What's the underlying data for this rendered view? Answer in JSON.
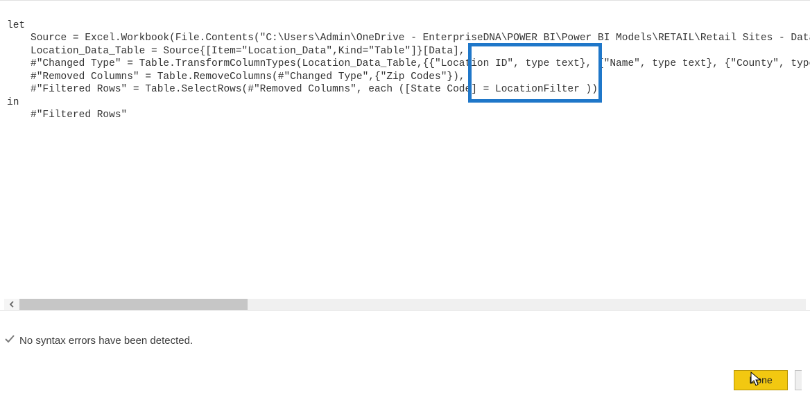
{
  "code": {
    "line1": "let",
    "line2": "Source = Excel.Workbook(File.Contents(\"C:\\Users\\Admin\\OneDrive - EnterpriseDNA\\POWER BI\\Power BI Models\\RETAIL\\Retail Sites - Data",
    "line3": "Location_Data_Table = Source{[Item=\"Location_Data\",Kind=\"Table\"]}[Data],",
    "line4": "#\"Changed Type\" = Table.TransformColumnTypes(Location_Data_Table,{{\"Location ID\", type text}, {\"Name\", type text}, {\"County\", type",
    "line5": "#\"Removed Columns\" = Table.RemoveColumns(#\"Changed Type\",{\"Zip Codes\"}),",
    "line6": "#\"Filtered Rows\" = Table.SelectRows(#\"Removed Columns\", each ([State Code] = LocationFilter ))",
    "line7": "in",
    "line8": "#\"Filtered Rows\""
  },
  "status": {
    "message": "No syntax errors have been detected."
  },
  "buttons": {
    "done": "Done"
  },
  "highlight": {
    "target": "= LocationFilter"
  }
}
